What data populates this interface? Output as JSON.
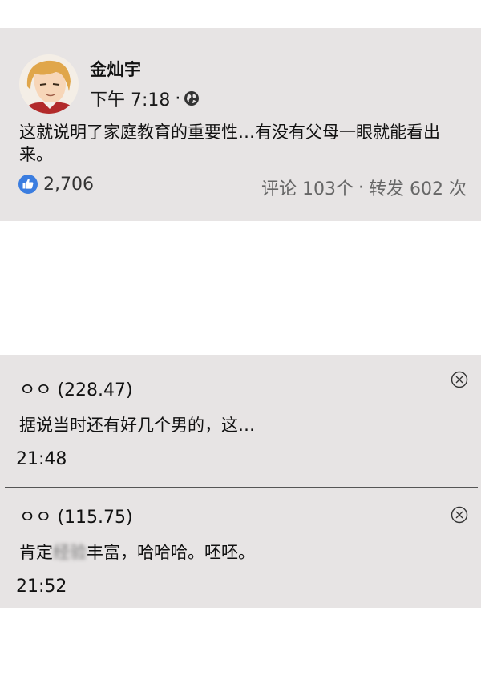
{
  "post": {
    "author": "金灿宇",
    "time": "下午 7:18",
    "meta_separator": "·",
    "text": "这就说明了家庭教育的重要性…有没有父母一眼就能看出来。",
    "likes": "2,706",
    "comments_label": "评论 103个",
    "stats_separator": "·",
    "shares_label": "转发 602 次",
    "icons": {
      "privacy": "globe-icon",
      "reaction": "like-icon"
    }
  },
  "comments": [
    {
      "name": "ㅇㅇ (228.47)",
      "text": "据说当时还有好几个男的，这…",
      "time": "21:48"
    },
    {
      "name": "ㅇㅇ (115.75)",
      "text_before": "肯定",
      "text_blurred": "经验",
      "text_after": "丰富，哈哈哈。呸呸。",
      "time": "21:52"
    }
  ],
  "colors": {
    "panel_bg": "#e7e4e4",
    "like_blue": "#3b7de0",
    "divider": "#555555"
  }
}
